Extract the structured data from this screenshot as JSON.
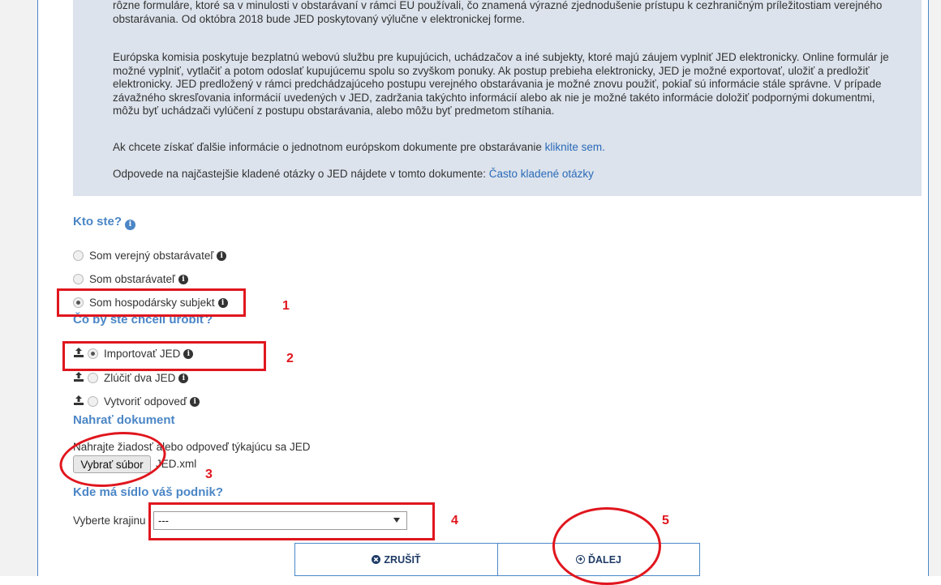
{
  "info": {
    "p1": "rôzne formuláre, ktoré sa v minulosti v obstarávaní v rámci EU používali, čo znamená výrazné zjednodušenie prístupu k cezhraničným príležitostiam verejného obstarávania. Od októbra 2018 bude JED poskytovaný výlučne v elektronickej forme.",
    "p2": "Európska komisia poskytuje bezplatnú webovú službu pre kupujúcich, uchádzačov a iné subjekty, ktoré majú záujem vyplniť JED elektronicky. Online formulár je možné vyplniť, vytlačiť a potom odoslať kupujúcemu spolu so zvyškom ponuky. Ak postup prebieha elektronicky, JED je možné exportovať, uložiť a predložiť elektronicky. JED predložený v rámci predchádzajúceho postupu verejného obstarávania je možné znovu použiť, pokiaľ sú informácie stále správne. V prípade závažného skresľovania informácií uvedených v JED, zadržania takýchto informácií alebo ak nie je možné takéto informácie doložiť podpornými dokumentmi, môžu byť uchádzači vylúčení z postupu obstarávania, alebo môžu byť predmetom stíhania.",
    "p3_text": "Ak chcete získať ďalšie informácie o jednotnom európskom dokumente pre obstarávanie ",
    "p3_link": "kliknite sem.",
    "p4_text": "Odpovede na najčastejšie kladené otázky o JED nájdete v tomto dokumente: ",
    "p4_link": "Často kladené otázky"
  },
  "who": {
    "heading": "Kto ste?",
    "options": [
      "Som verejný obstarávateľ",
      "Som obstarávateľ",
      "Som hospodársky subjekt"
    ],
    "selected": 2
  },
  "action": {
    "heading": "Čo by ste chceli urobiť?",
    "options": [
      "Importovať JED",
      "Zlúčiť dva JED",
      "Vytvoriť odpoveď"
    ],
    "selected": 0
  },
  "upload": {
    "heading": "Nahrať dokument",
    "label": "Nahrajte žiadosť alebo odpoveď týkajúcu sa JED",
    "button": "Vybrať súbor",
    "filename": "JED.xml"
  },
  "country": {
    "heading": "Kde má sídlo váš podnik?",
    "label": "Vyberte krajinu",
    "value": "---"
  },
  "buttons": {
    "cancel": "ZRUŠIŤ",
    "next": "ĎALEJ"
  },
  "annotations": [
    "1",
    "2",
    "3",
    "4",
    "5"
  ],
  "colors": {
    "accent": "#4b86c6",
    "annotation": "#e0161e",
    "infobox_bg": "#dce3ec"
  }
}
